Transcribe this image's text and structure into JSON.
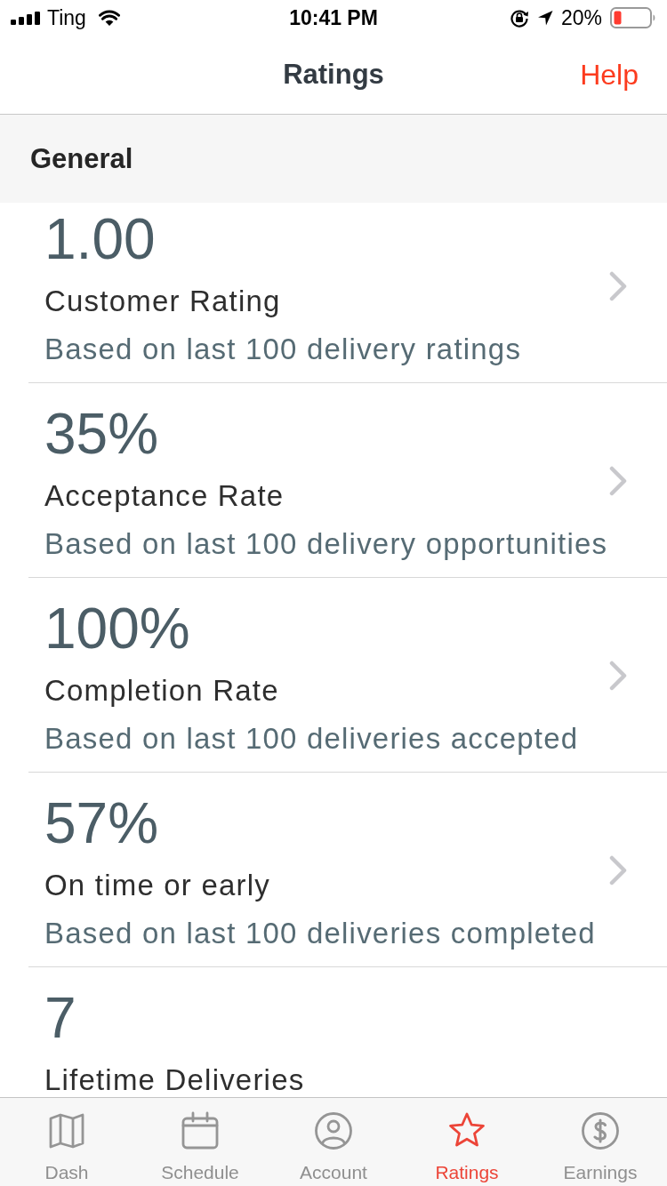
{
  "status_bar": {
    "carrier": "Ting",
    "time": "10:41 PM",
    "battery": "20%"
  },
  "nav_bar": {
    "title": "Ratings",
    "action": "Help"
  },
  "section": {
    "title": "General"
  },
  "metrics": [
    {
      "value": "1.00",
      "title": "Customer Rating",
      "subtitle": "Based on last 100 delivery ratings",
      "chevron": true
    },
    {
      "value": "35%",
      "title": "Acceptance Rate",
      "subtitle": "Based on last 100 delivery opportunities",
      "chevron": true
    },
    {
      "value": "100%",
      "title": "Completion Rate",
      "subtitle": "Based on last 100 deliveries accepted",
      "chevron": true
    },
    {
      "value": "57%",
      "title": "On time or early",
      "subtitle": "Based on last 100 deliveries completed",
      "chevron": true
    },
    {
      "value": "7",
      "title": "Lifetime Deliveries",
      "chevron": false
    }
  ],
  "tab_bar": [
    {
      "label": "Dash",
      "selected": false
    },
    {
      "label": "Schedule",
      "selected": false
    },
    {
      "label": "Account",
      "selected": false
    },
    {
      "label": "Ratings",
      "selected": true
    },
    {
      "label": "Earnings",
      "selected": false
    }
  ]
}
